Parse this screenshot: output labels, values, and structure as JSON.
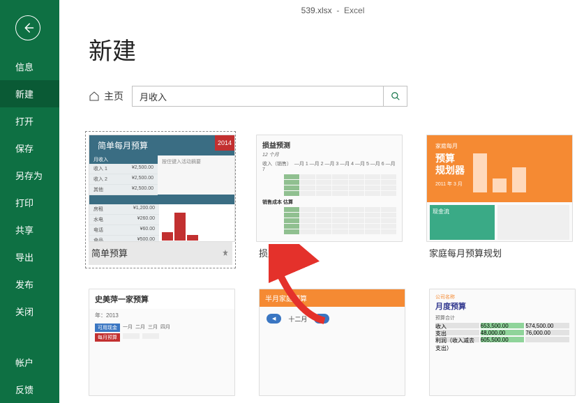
{
  "titlebar": {
    "filename": "539.xlsx",
    "sep": "-",
    "app": "Excel"
  },
  "page": {
    "title": "新建"
  },
  "nav": {
    "items": [
      {
        "label": "信息"
      },
      {
        "label": "新建",
        "active": true
      },
      {
        "label": "打开"
      },
      {
        "label": "保存"
      },
      {
        "label": "另存为"
      },
      {
        "label": "打印"
      },
      {
        "label": "共享"
      },
      {
        "label": "导出"
      },
      {
        "label": "发布"
      },
      {
        "label": "关闭"
      }
    ],
    "footer": [
      {
        "label": "帐户"
      },
      {
        "label": "反馈"
      }
    ]
  },
  "search": {
    "breadcrumb": "主页",
    "value": "月收入"
  },
  "templates": [
    {
      "label": "简单预算",
      "selected": true,
      "thumb_title": "简单每月预算",
      "thumb_year": "2014"
    },
    {
      "label": "损益表",
      "thumb_title": "损益预测",
      "thumb_sub": "12 个月"
    },
    {
      "label": "家庭每月预算规划",
      "thumb_over": "家庭每月",
      "thumb_title": "预算\n规划器",
      "thumb_date": "2011 年 3 月",
      "thumb_cash": "现金流"
    },
    {
      "label": "",
      "thumb_title": "史美萍一家预算",
      "thumb_sub": "年：2013"
    },
    {
      "label": "",
      "thumb_title": "半月家庭预算",
      "thumb_month": "十二月"
    },
    {
      "label": "",
      "thumb_over": "公司名称",
      "thumb_title": "月度预算"
    }
  ]
}
